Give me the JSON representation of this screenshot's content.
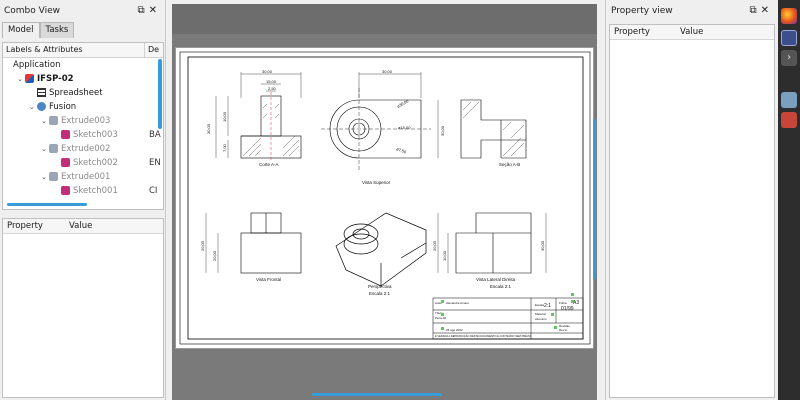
{
  "combo": {
    "title": "Combo View",
    "dock_buttons": "⧉✕",
    "tabs": [
      {
        "label": "Model"
      },
      {
        "label": "Tasks"
      }
    ],
    "tree_headers": [
      "Labels & Attributes",
      "De"
    ],
    "tree": [
      {
        "label": "Application",
        "indent": 0,
        "arrow": "",
        "icon": "",
        "side": ""
      },
      {
        "label": "IFSP-02",
        "indent": 1,
        "arrow": "⌄",
        "icon": "document",
        "side": ""
      },
      {
        "label": "Spreadsheet",
        "indent": 2,
        "arrow": "",
        "icon": "spreadsheet",
        "side": ""
      },
      {
        "label": "Fusion",
        "indent": 2,
        "arrow": "⌄",
        "icon": "fusion",
        "side": ""
      },
      {
        "label": "Extrude003",
        "indent": 3,
        "arrow": "⌄",
        "icon": "extrude",
        "side": ""
      },
      {
        "label": "Sketch003",
        "indent": 4,
        "arrow": "",
        "icon": "sketch",
        "side": "BA"
      },
      {
        "label": "Extrude002",
        "indent": 3,
        "arrow": "⌄",
        "icon": "extrude",
        "side": ""
      },
      {
        "label": "Sketch002",
        "indent": 4,
        "arrow": "",
        "icon": "sketch",
        "side": "EN"
      },
      {
        "label": "Extrude001",
        "indent": 3,
        "arrow": "⌄",
        "icon": "extrude",
        "side": ""
      },
      {
        "label": "Sketch001",
        "indent": 4,
        "arrow": "",
        "icon": "sketch",
        "side": "CI"
      }
    ],
    "property_headers": [
      "Property",
      "Value"
    ]
  },
  "right_dock": {
    "title": "Property view",
    "dock_buttons": "⧉✕",
    "property_headers": [
      "Property",
      "Value"
    ]
  },
  "drawing": {
    "view_labels": {
      "top_left_view": "Corte A-A",
      "top_middle_view": "Vista Superior",
      "top_right_view": "Seção A-B",
      "bottom_left_view": "Vista Frontal",
      "perspective": "Perspectiva",
      "perspective_scale": "Escala 2:1",
      "side_view": "Vista Lateral Direita",
      "side_scale": "Escala 2:1"
    },
    "dimensions": {
      "d30_left": "30,00",
      "d15": "15,00",
      "d2_5": "2,50",
      "d30_vert": "30,00",
      "d10": "10,00",
      "d7": "7,00",
      "d30_mid": "30,00",
      "d30_circ": "ø30,00",
      "d15_circ": "ø15,00",
      "d7_5": "ø7,50",
      "d30_right": "30,00",
      "d20_front": "20,00",
      "d20_front2": "20,00",
      "d10_front": "10,00",
      "d20_side": "20,00",
      "d10_side": "10,00",
      "d30_side": "30,00"
    },
    "title_block": {
      "scale_label": "Escala",
      "scale": "2:1",
      "sheet_label": "Folha",
      "sheet_size": "A3",
      "sheet_number": "01/99",
      "author_label": "Autor",
      "author": "Alexandre Amaro",
      "material_label": "Material",
      "material": "Aluminio",
      "title_label": "Título",
      "title": "Peca-02",
      "revision_label": "Revisão",
      "revision": "Rev A",
      "date": "25 ago 2022",
      "footer": "É VEDADA A REPRODUÇÃO DESTE DOCUMENTO E CONTEÚDO SEM PRÉVIA"
    }
  }
}
